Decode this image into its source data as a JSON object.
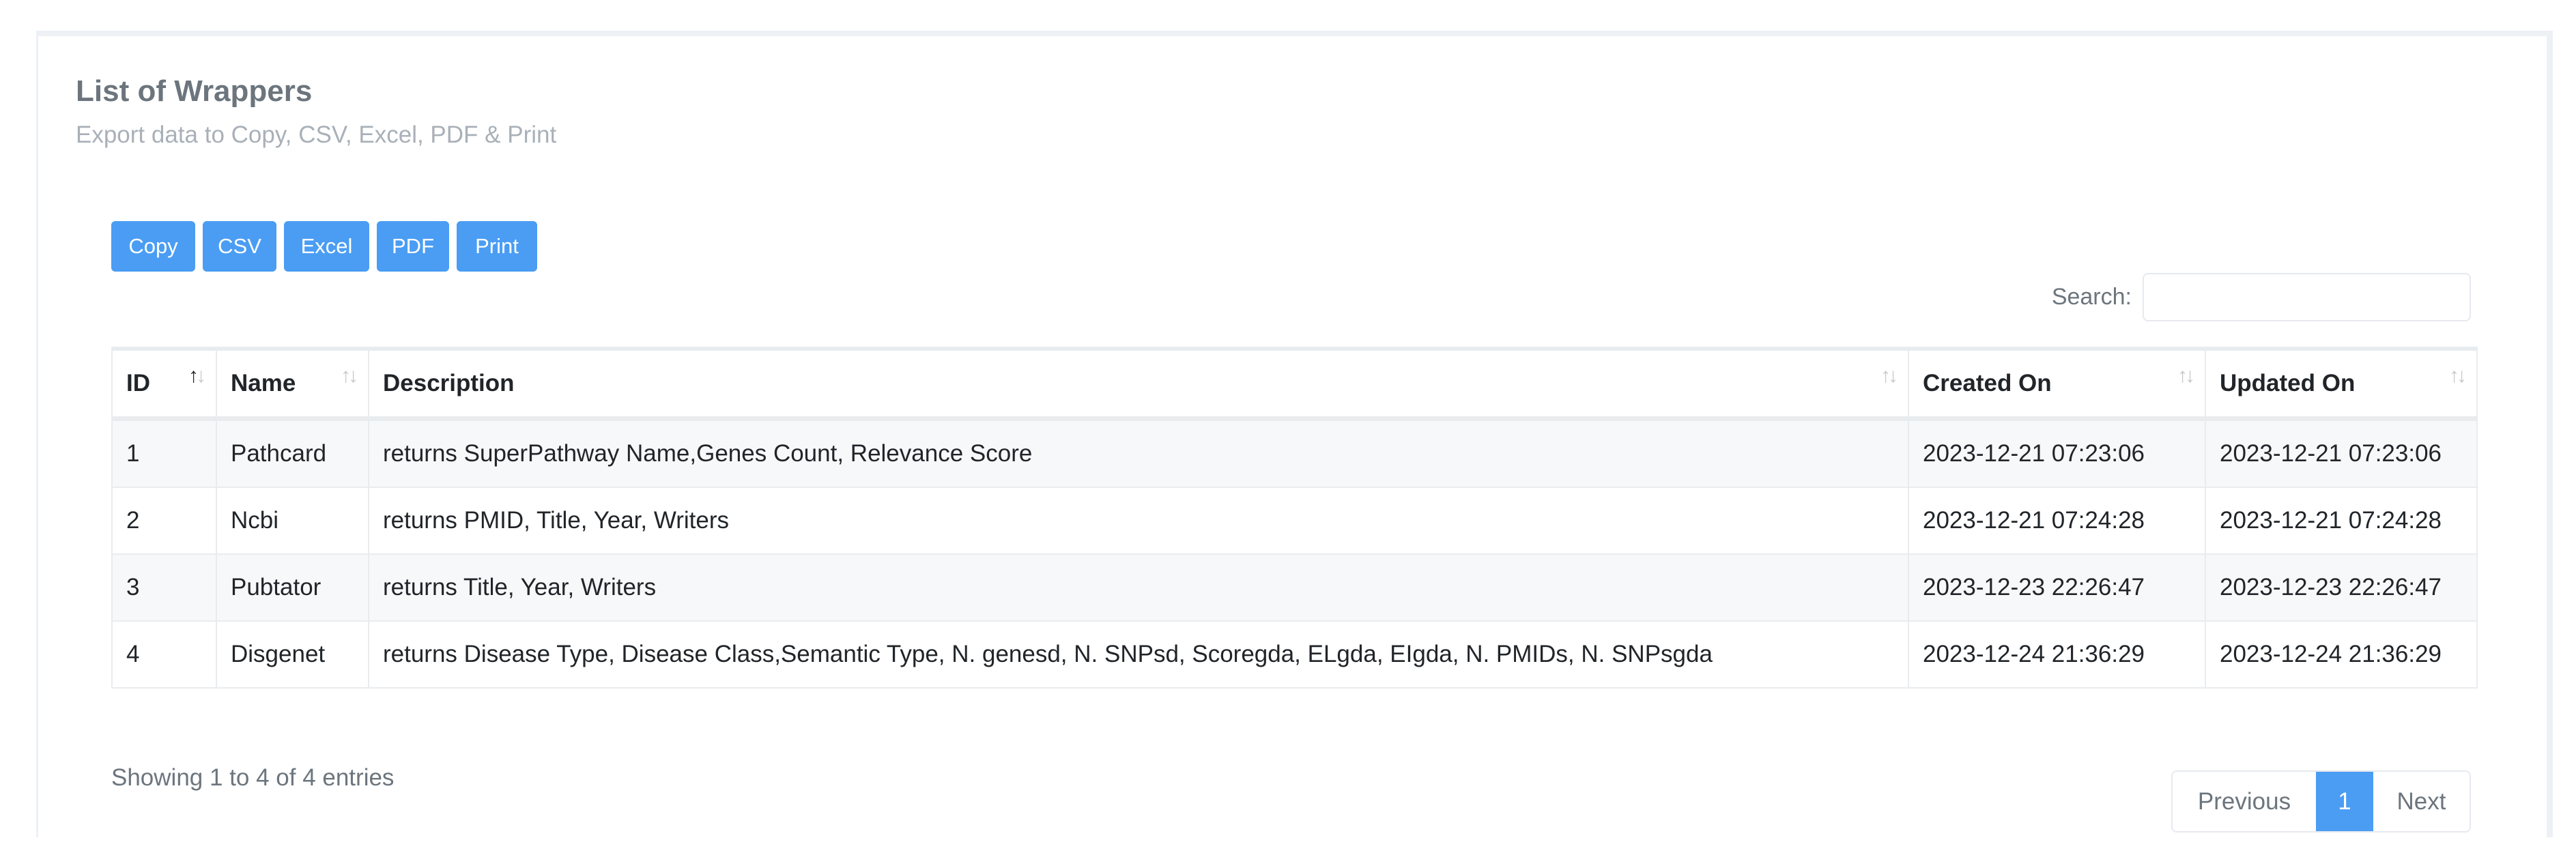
{
  "header": {
    "title": "List of Wrappers",
    "subtitle": "Export data to Copy, CSV, Excel, PDF & Print"
  },
  "export_buttons": {
    "copy": "Copy",
    "csv": "CSV",
    "excel": "Excel",
    "pdf": "PDF",
    "print": "Print"
  },
  "search": {
    "label": "Search:",
    "value": "",
    "placeholder": ""
  },
  "table": {
    "columns": [
      {
        "label": "ID",
        "sort": "ascending"
      },
      {
        "label": "Name",
        "sort": "none"
      },
      {
        "label": "Description",
        "sort": "none"
      },
      {
        "label": "Created On",
        "sort": "none"
      },
      {
        "label": "Updated On",
        "sort": "none"
      }
    ],
    "sort_icon": {
      "up": "↑",
      "down": "↓"
    },
    "rows": [
      {
        "id": "1",
        "name": "Pathcard",
        "description": "returns SuperPathway Name,Genes Count, Relevance Score",
        "created_on": "2023-12-21 07:23:06",
        "updated_on": "2023-12-21 07:23:06"
      },
      {
        "id": "2",
        "name": "Ncbi",
        "description": "returns PMID, Title, Year, Writers",
        "created_on": "2023-12-21 07:24:28",
        "updated_on": "2023-12-21 07:24:28"
      },
      {
        "id": "3",
        "name": "Pubtator",
        "description": "returns Title, Year, Writers",
        "created_on": "2023-12-23 22:26:47",
        "updated_on": "2023-12-23 22:26:47"
      },
      {
        "id": "4",
        "name": "Disgenet",
        "description": "returns Disease Type, Disease Class,Semantic Type, N. genesd, N. SNPsd, Scoregda, ELgda, EIgda, N. PMIDs, N. SNPsgda",
        "created_on": "2023-12-24 21:36:29",
        "updated_on": "2023-12-24 21:36:29"
      }
    ]
  },
  "footer": {
    "info": "Showing 1 to 4 of 4 entries",
    "pagination": {
      "previous": "Previous",
      "current_page": "1",
      "next": "Next"
    }
  },
  "colors": {
    "accent": "#4a9df3",
    "title": "#6c757d",
    "subtitle": "#a9b0b8",
    "border": "#e9ecef",
    "stripe": "#f7f8fa"
  }
}
